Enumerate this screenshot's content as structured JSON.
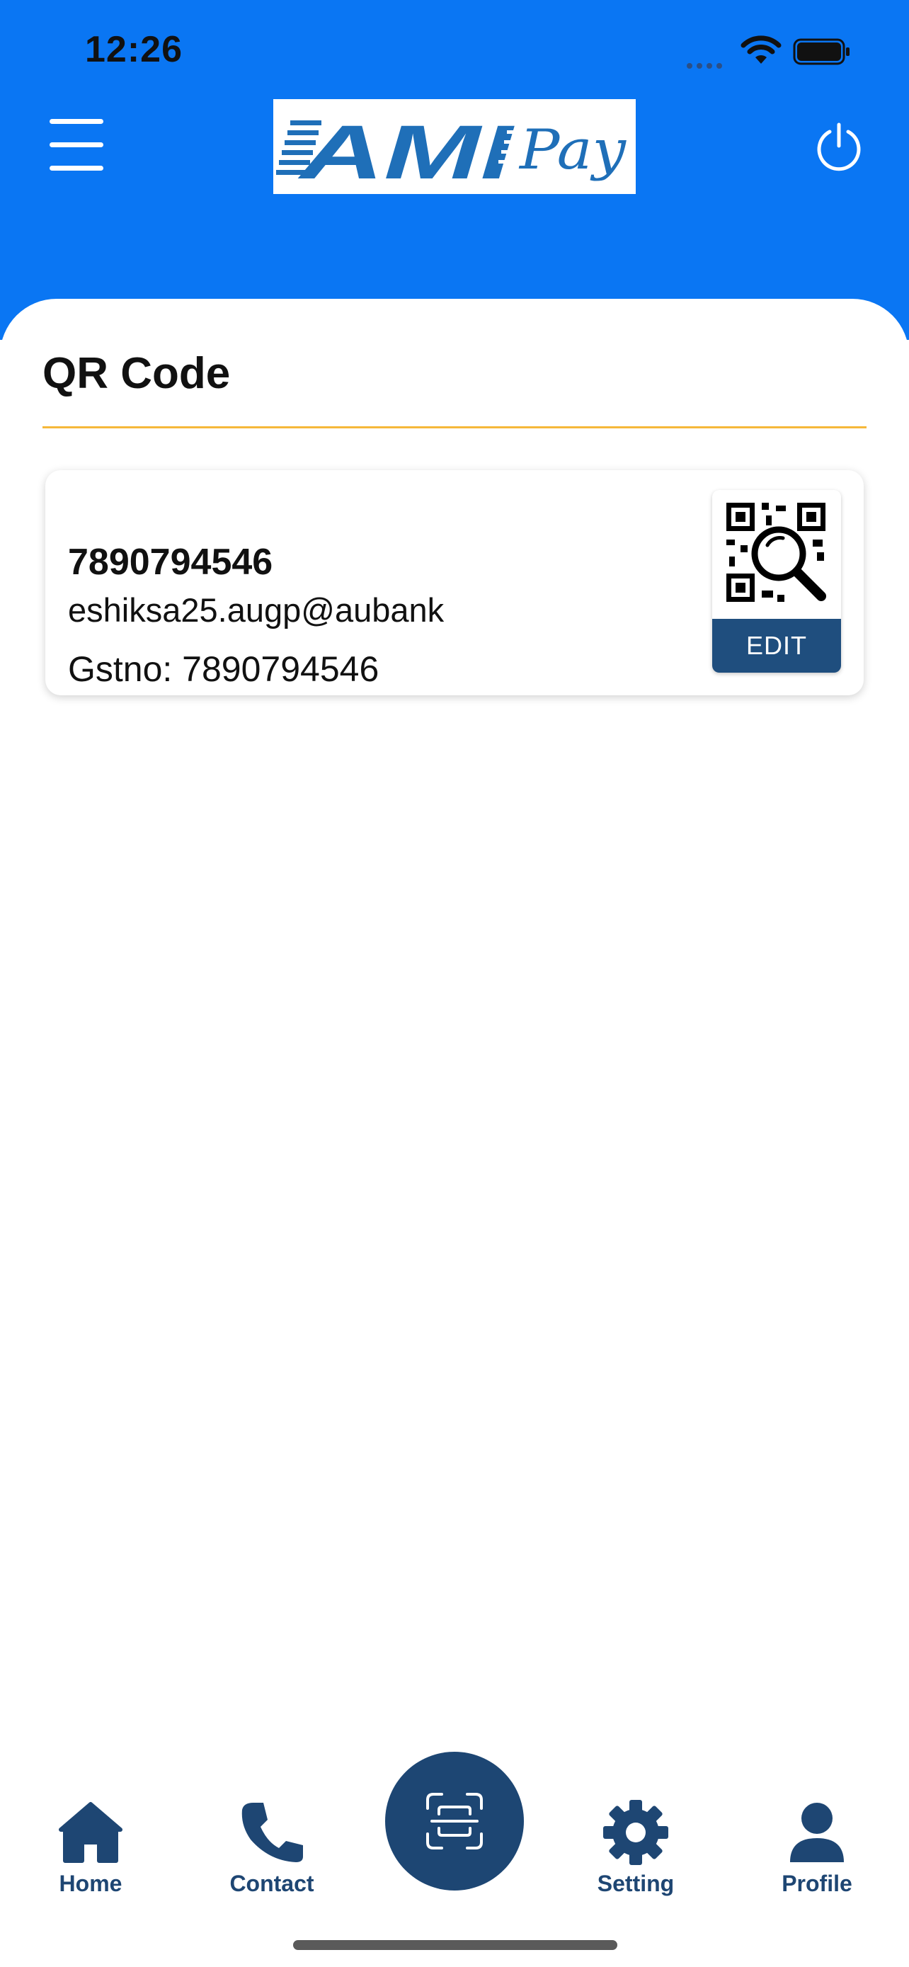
{
  "status_bar": {
    "time": "12:26"
  },
  "header": {
    "menu_icon": "hamburger-menu-icon",
    "logo_text_main": "AMI",
    "logo_text_script": "Pay",
    "power_icon": "power-icon",
    "brand_color": "#0a76f3"
  },
  "page": {
    "title": "QR Code",
    "divider_color": "#f6b83a"
  },
  "qr_card": {
    "phone": "7890794546",
    "upi_id": "eshiksa25.augp@aubank",
    "gst": "Gstno: 7890794546",
    "thumbnail_icon": "qr-search-icon",
    "edit_label": "EDIT",
    "edit_color": "#1f4e7e"
  },
  "bottom_nav": {
    "items": [
      {
        "label": "Home",
        "icon": "home-icon"
      },
      {
        "label": "Contact",
        "icon": "phone-icon"
      },
      {
        "label": "Setting",
        "icon": "gear-icon"
      },
      {
        "label": "Profile",
        "icon": "user-icon"
      }
    ],
    "scan_icon": "scan-icon",
    "accent": "#1d4673"
  }
}
